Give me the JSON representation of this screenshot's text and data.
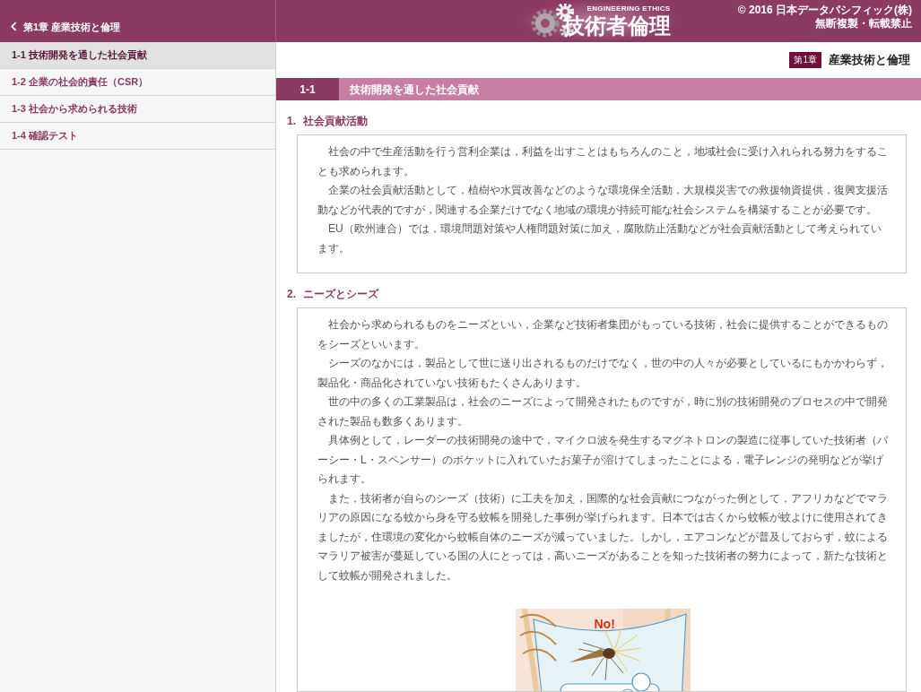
{
  "header": {
    "back_label": "第1章 産業技術と倫理",
    "logo": {
      "subtitle": "ENGINEERING ETHICS",
      "title": "技術者倫理"
    },
    "copyright": [
      "© 2016 日本データパシフィック(株)",
      "無断複製・転載禁止"
    ]
  },
  "sidebar": {
    "items": [
      {
        "label": "1-1 技術開発を通した社会貢献",
        "selected": true
      },
      {
        "label": "1-2 企業の社会的責任（CSR）",
        "selected": false
      },
      {
        "label": "1-3 社会から求められる技術",
        "selected": false
      },
      {
        "label": "1-4 確認テスト",
        "selected": false
      }
    ]
  },
  "chapter": {
    "badge": "第1章",
    "title": "産業技術と倫理"
  },
  "section": {
    "number": "1-1",
    "title": "技術開発を通した社会貢献"
  },
  "subsections": [
    {
      "number": "1.",
      "title": "社会貢献活動",
      "paragraphs": [
        "社会の中で生産活動を行う営利企業は，利益を出すことはもちろんのこと，地域社会に受け入れられる努力をすることも求められます。",
        "企業の社会貢献活動として，植樹や水質改善などのような環境保全活動，大規模災害での救援物資提供，復興支援活動などが代表的ですが，関連する企業だけでなく地域の環境が持続可能な社会システムを構築することが必要です。",
        "EU（欧州連合）では，環境問題対策や人権問題対策に加え，腐敗防止活動などが社会貢献活動として考えられています。"
      ]
    },
    {
      "number": "2.",
      "title": "ニーズとシーズ",
      "paragraphs": [
        "社会から求められるものをニーズといい，企業など技術者集団がもっている技術，社会に提供することができるものをシーズといいます。",
        "シーズのなかには，製品として世に送り出されるものだけでなく，世の中の人々が必要としているにもかかわらず，製品化・商品化されていない技術もたくさんあります。",
        "世の中の多くの工業製品は，社会のニーズによって開発されたものですが，時に別の技術開発のプロセスの中で開発された製品も数多くあります。",
        "具体例として，レーダーの技術開発の途中で，マイクロ波を発生するマグネトロンの製造に従事していた技術者（パーシー・L・スペンサー）のポケットに入れていたお菓子が溶けてしまったことによる，電子レンジの発明などが挙げられます。",
        "また，技術者が自らのシーズ（技術）に工夫を加え，国際的な社会貢献につながった例として，アフリカなどでマラリアの原因になる蚊から身を守る蚊帳を開発した事例が挙げられます。日本では古くから蚊帳が蚊よけに使用されてきましたが，住環境の変化から蚊帳自体のニーズが減っていました。しかし，エアコンなどが普及しておらず，蚊によるマラリア被害が蔓延している国の人にとっては，高いニーズがあることを知った技術者の努力によって，新たな技術として蚊帳が開発されました。"
      ],
      "illustration": {
        "caption": "No!"
      }
    }
  ]
}
